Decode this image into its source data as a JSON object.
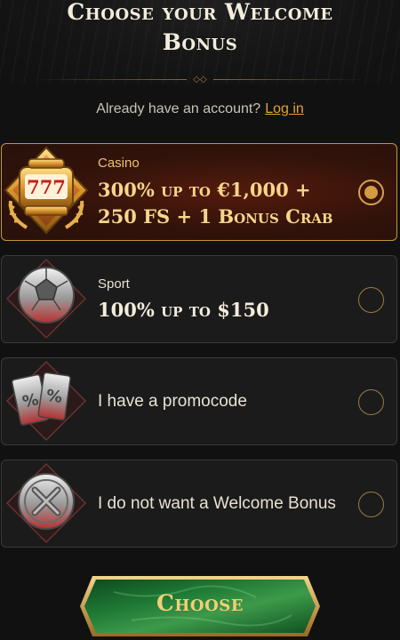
{
  "header": {
    "title_line1": "Choose your Welcome",
    "title_line2": "Bonus"
  },
  "account": {
    "prompt": "Already have an account?",
    "login_label": "Log in"
  },
  "options": [
    {
      "category": "Casino",
      "offer_line1": "300% up to €1,000 +",
      "offer_line2": "250 FS + 1 Bonus Crab",
      "icon": "slot-machine-777-icon",
      "selected": true
    },
    {
      "category": "Sport",
      "offer_line1": "100% up to $150",
      "icon": "soccer-ball-icon",
      "selected": false
    },
    {
      "label": "I have a promocode",
      "icon": "percent-tickets-icon",
      "selected": false
    },
    {
      "label": "I do not want a Welcome Bonus",
      "icon": "cross-coin-icon",
      "selected": false
    }
  ],
  "cta": {
    "label": "Choose"
  },
  "colors": {
    "accent_gold": "#d39c43",
    "link": "#e0a33c",
    "cta_green": "#1f7a35"
  }
}
